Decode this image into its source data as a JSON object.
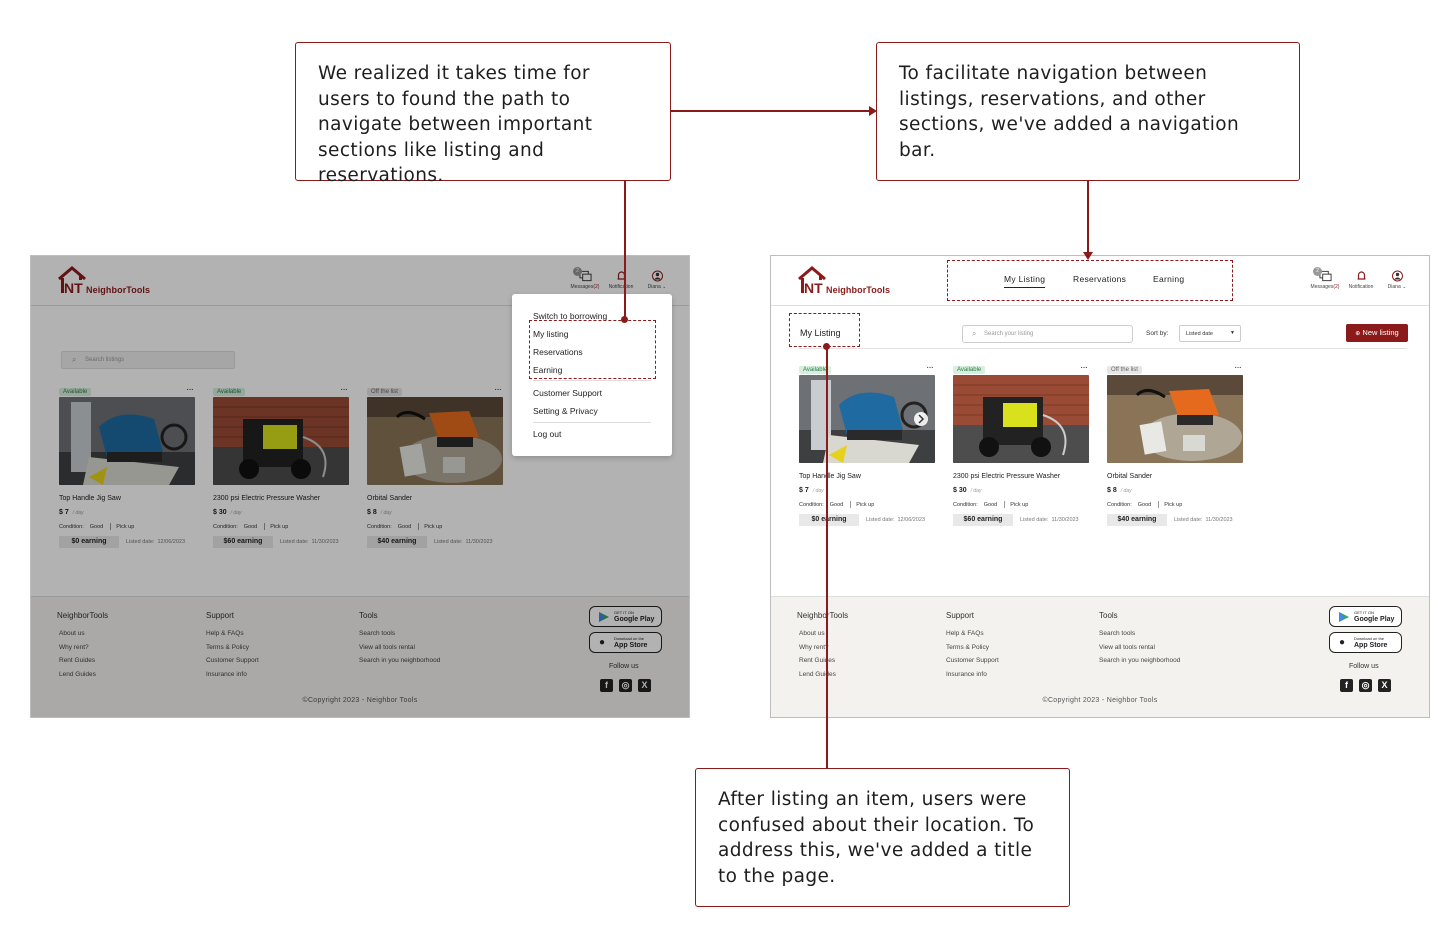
{
  "callouts": {
    "top_left": "We realized it takes time for users to found the path to navigate between important sections like listing and reservations.",
    "top_right": "To facilitate navigation between listings, reservations, and other sections, we've added a navigation bar.",
    "bottom": "After listing an item, users were confused about their location. To address this, we've added a title to the page."
  },
  "brand": {
    "logo_mark": "NT",
    "name": "NeighborTools",
    "color": "#8b1a1a"
  },
  "header": {
    "messages_label": "Messages",
    "messages_count": "(2)",
    "messages_badge": "2",
    "notification_label": "Notification",
    "user_label": "Diana"
  },
  "nav": {
    "tabs": [
      "My Listing",
      "Reservations",
      "Earning"
    ],
    "active": "My Listing"
  },
  "page": {
    "title": "My Listing",
    "search_placeholder": "Search your listing",
    "old_search_placeholder": "Search listings",
    "sort_label": "Sort by:",
    "sort_value": "Listed date",
    "new_listing_label": "New listing"
  },
  "dropdown": {
    "items": [
      "Switch to borrowing",
      "My listing",
      "Reservations",
      "Earning",
      "Customer Support",
      "Setting & Privacy",
      "Log out"
    ]
  },
  "listings": [
    {
      "status": "Available",
      "status_type": "available",
      "name": "Top Handle Jig Saw",
      "price": "$ 7",
      "unit": "/ day",
      "condition_label": "Condition:",
      "condition": "Good",
      "pickup": "Pick up",
      "earning": "$0 earning",
      "listed_label": "Listed date:",
      "listed_date": "12/06/2023",
      "photo": "blue-jigsaw"
    },
    {
      "status": "Available",
      "status_type": "available",
      "name": "2300 psi Electric Pressure Washer",
      "price": "$ 30",
      "unit": "/ day",
      "condition_label": "Condition:",
      "condition": "Good",
      "pickup": "Pick up",
      "earning": "$60 earning",
      "listed_label": "Listed date:",
      "listed_date": "11/30/2023",
      "photo": "yellow-pressure-washer"
    },
    {
      "status": "Off the list",
      "status_type": "off",
      "name": "Orbital Sander",
      "price": "$ 8",
      "unit": "/ day",
      "condition_label": "Condition:",
      "condition": "Good",
      "pickup": "Pick up",
      "earning": "$40 earning",
      "listed_label": "Listed date:",
      "listed_date": "11/30/2023",
      "photo": "orange-sander"
    }
  ],
  "footer": {
    "col1": {
      "title": "NeighborTools",
      "items": [
        "About us",
        "Why rent?",
        "Rent  Guides",
        "Lend  Guides"
      ]
    },
    "col2": {
      "title": "Support",
      "items": [
        "Help & FAQs",
        "Terms & Policy",
        "Customer Support",
        "Insurance info"
      ]
    },
    "col3": {
      "title": "Tools",
      "items": [
        "Search tools",
        "View all tools rental",
        "Search in you neighborhood"
      ]
    },
    "google_small": "GET IT ON",
    "google_big": "Google Play",
    "apple_small": "Download on the",
    "apple_big": "App Store",
    "follow": "Follow us",
    "copyright": "©Copyright 2023 - Neighbor Tools"
  },
  "icons": [
    "message-icon",
    "bell-icon",
    "user-icon",
    "search-icon",
    "chevron-down-icon",
    "plus-circle-icon",
    "more-icon",
    "google-play-icon",
    "apple-icon",
    "facebook-icon",
    "instagram-icon",
    "x-icon"
  ],
  "colors": {
    "accent": "#8b1a1a",
    "available": "#2d7a47",
    "overlay": "rgba(0,0,0,0.30)"
  }
}
